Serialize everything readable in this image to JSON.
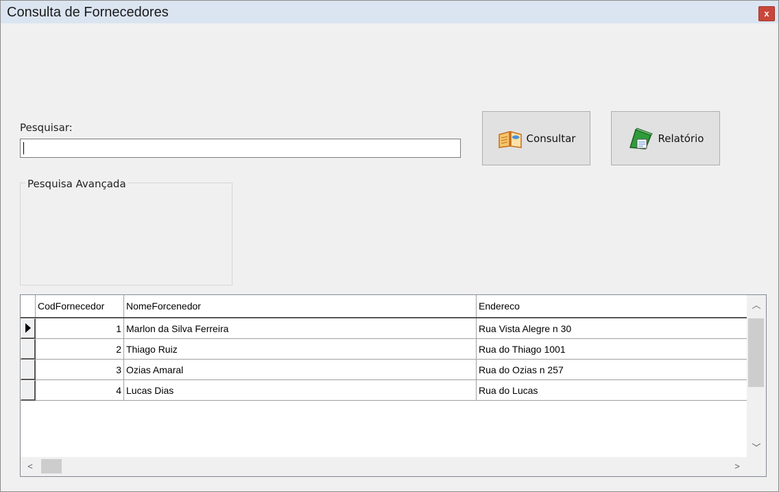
{
  "window": {
    "title": "Consulta de Fornecedores",
    "close_label": "x"
  },
  "search": {
    "label": "Pesquisar:",
    "value": ""
  },
  "buttons": {
    "consultar": "Consultar",
    "relatorio": "Relatório"
  },
  "group": {
    "label": "Pesquisa Avançada"
  },
  "grid": {
    "columns": [
      "CodFornecedor",
      "NomeForcenedor",
      "Endereco"
    ],
    "rows": [
      {
        "cod": "1",
        "nome": "Marlon da Silva Ferreira",
        "endereco": "Rua Vista Alegre n 30"
      },
      {
        "cod": "2",
        "nome": "Thiago Ruiz",
        "endereco": "Rua do Thiago 1001"
      },
      {
        "cod": "3",
        "nome": "Ozias Amaral",
        "endereco": "Rua do Ozias n 257"
      },
      {
        "cod": "4",
        "nome": "Lucas Dias",
        "endereco": "Rua do Lucas"
      }
    ]
  }
}
